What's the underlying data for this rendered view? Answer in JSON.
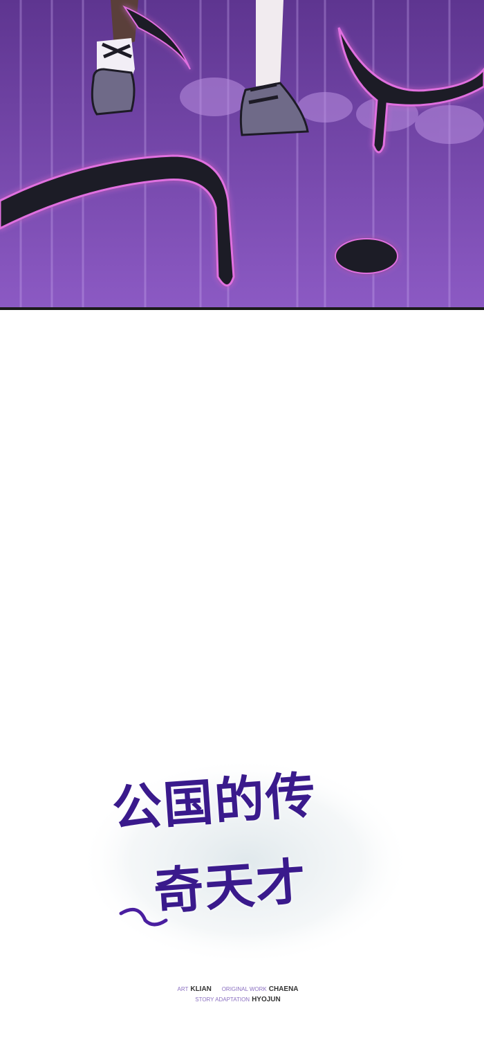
{
  "title": {
    "line1": "公国的传",
    "line2": "奇天才"
  },
  "credits": {
    "art_label": "ART",
    "art_value": "KLIAN",
    "original_label": "ORIGINAL WORK",
    "original_value": "CHAENA",
    "story_label": "STORY ADAPTATION",
    "story_value": "HYOJUN"
  },
  "colors": {
    "title": "#3a1a8c",
    "panel_background": "#7a4ab0",
    "tendril": "#1c1a26",
    "glow": "#e070e0"
  }
}
